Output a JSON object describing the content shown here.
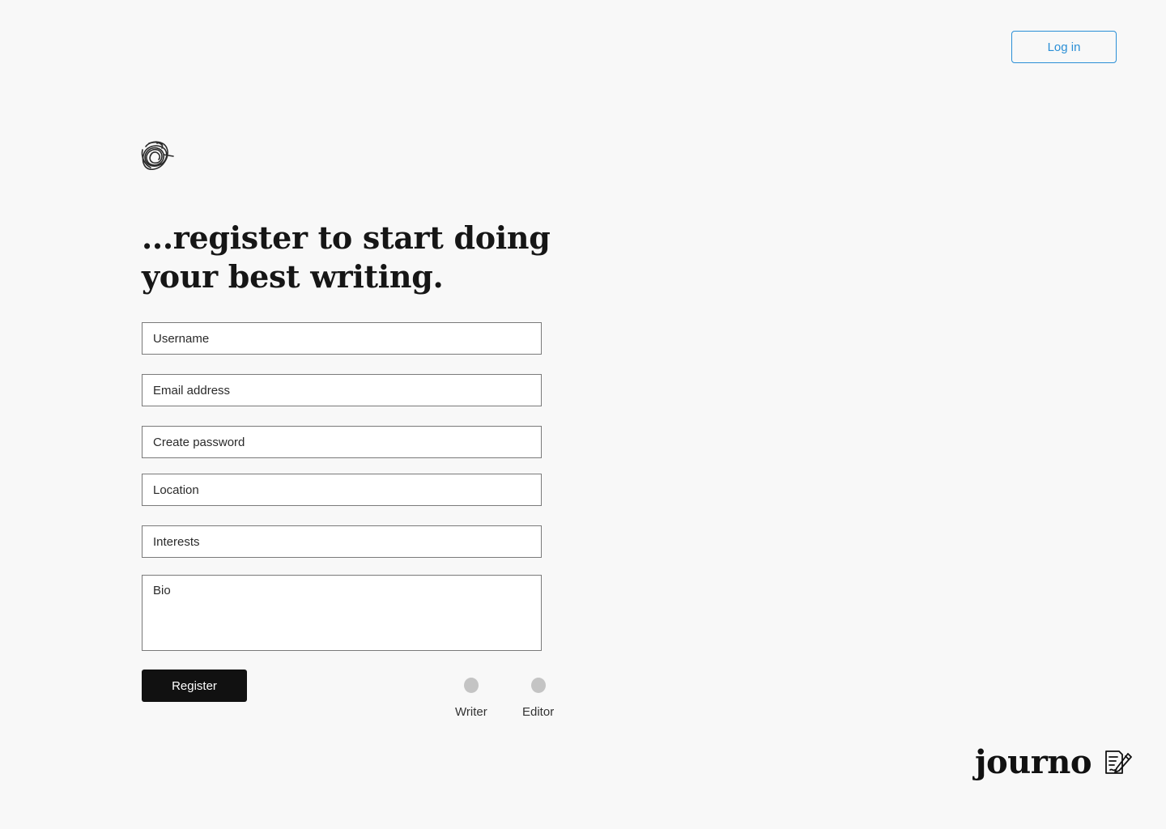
{
  "header": {
    "login_label": "Log in"
  },
  "hero": {
    "headline_line1": "...register to start doing",
    "headline_line2": "your best writing."
  },
  "form": {
    "username_placeholder": "Username",
    "email_placeholder": "Email address",
    "password_placeholder": "Create password",
    "location_placeholder": "Location",
    "interests_placeholder": "Interests",
    "bio_placeholder": "Bio",
    "register_label": "Register",
    "roles": [
      {
        "label": "Writer",
        "selected": false
      },
      {
        "label": "Editor",
        "selected": false
      }
    ]
  },
  "brand": {
    "name": "journo",
    "icon": "document-pen-icon"
  },
  "colors": {
    "accent": "#2a8fd6",
    "primary_button": "#111111",
    "background": "#f8f8f8",
    "radio_unselected": "#c4c4c4"
  }
}
